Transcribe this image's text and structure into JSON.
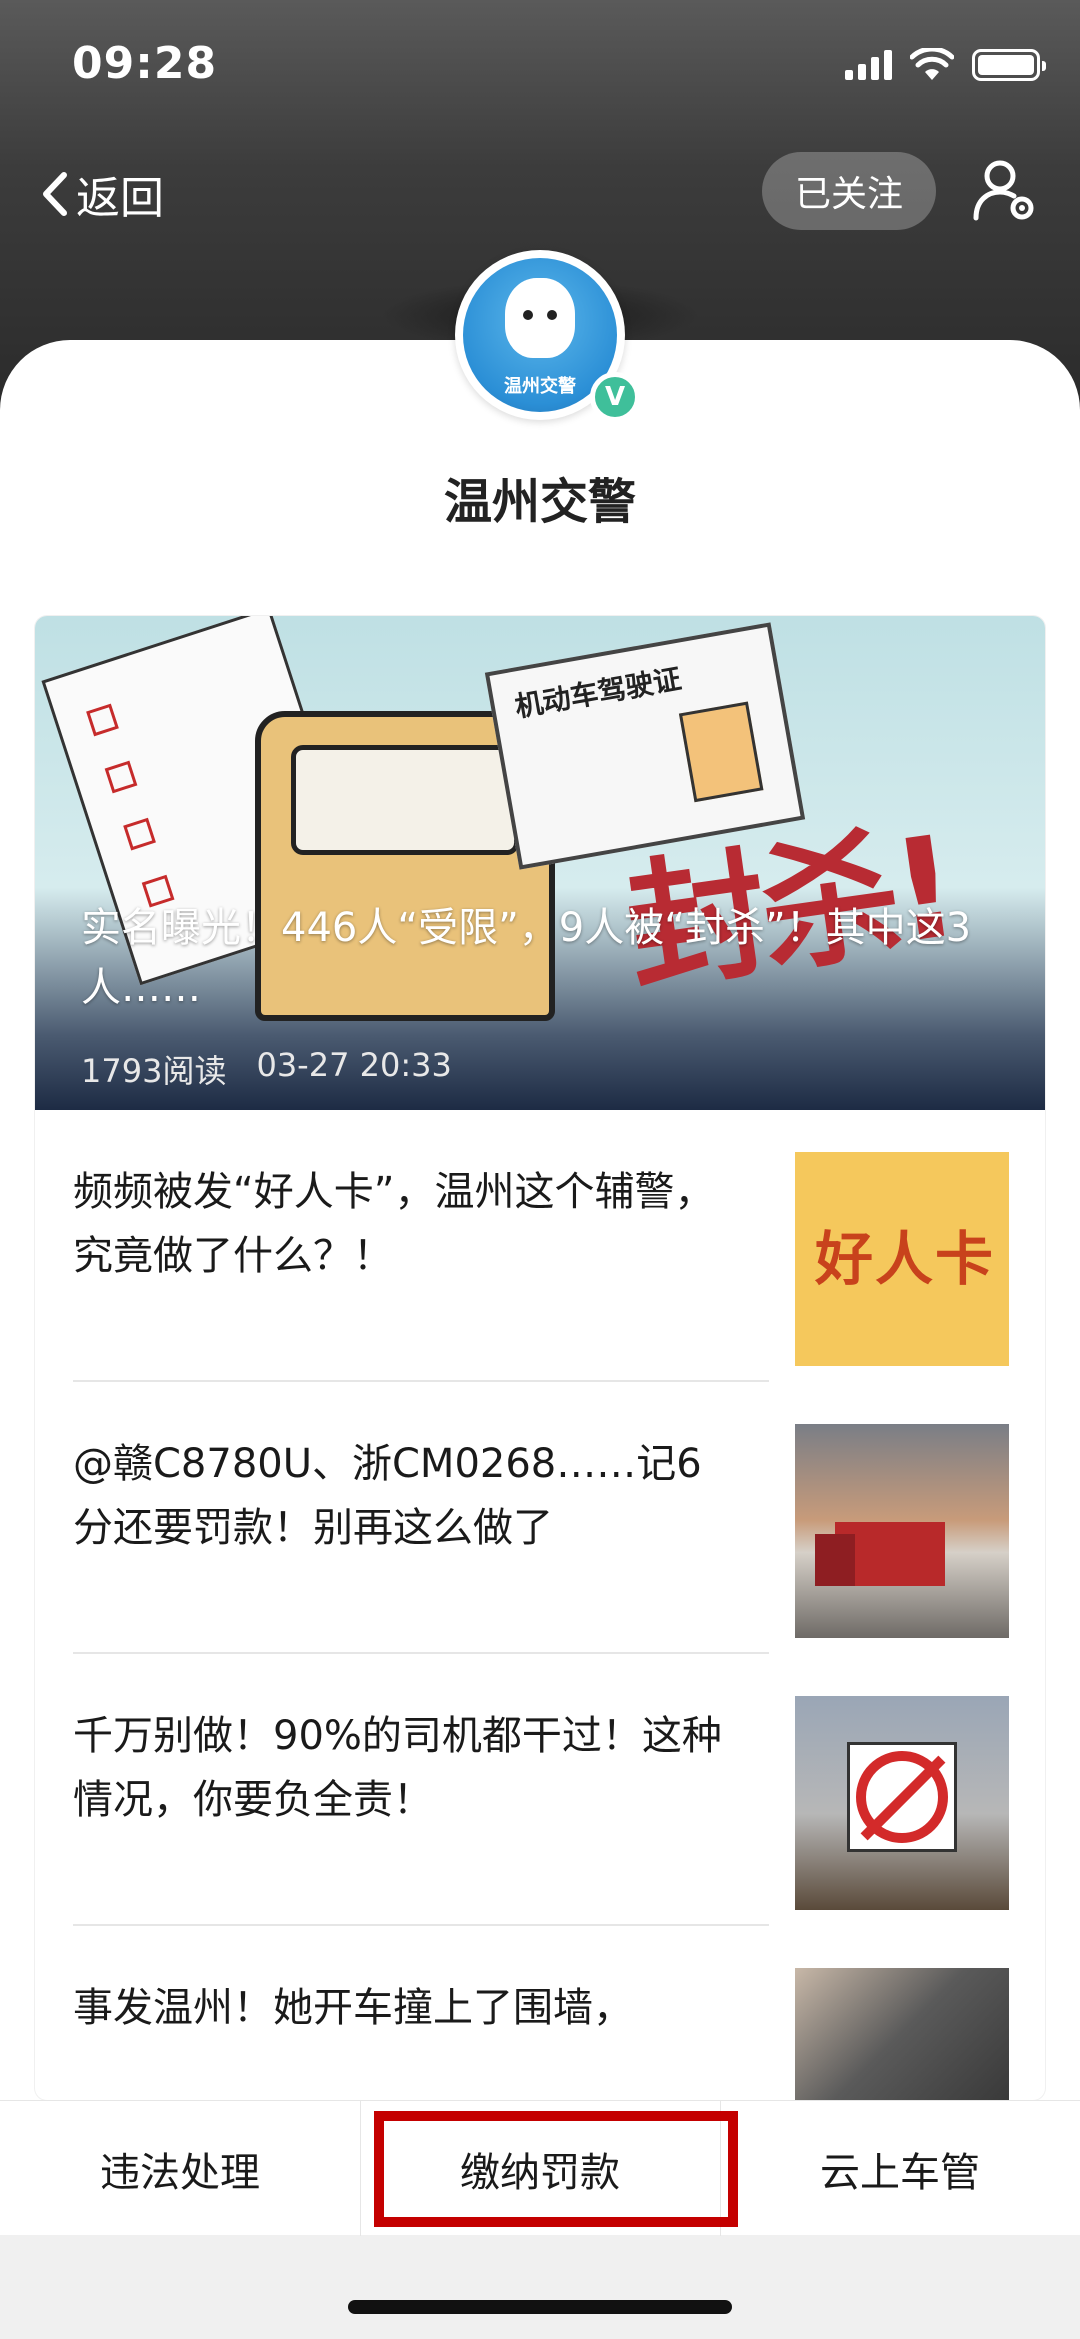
{
  "status_bar": {
    "time": "09:28",
    "signal_icon": "signal-icon",
    "wifi_icon": "wifi-icon",
    "battery_icon": "battery-icon"
  },
  "nav": {
    "back_label": "返回",
    "follow_label": "已关注",
    "settings_icon": "user-settings-icon"
  },
  "account": {
    "name": "温州交警",
    "avatar_text": "温州交警",
    "verified_badge": "V"
  },
  "hero": {
    "title": "实名曝光！446人“受限”，9人被“封杀”！其中这3人……",
    "reads": "1793阅读",
    "date": "03-27 20:33",
    "license_title": "机动车驾驶证",
    "stamp_text": "封杀!"
  },
  "articles": [
    {
      "title": "频频被发“好人卡”，温州这个辅警，究竟做了什么？！",
      "thumb_text": "好人卡"
    },
    {
      "title": "@赣C8780U、浙CM0268……记6分还要罚款！别再这么做了"
    },
    {
      "title": "千万别做！90%的司机都干过！这种情况，你要负全责！"
    },
    {
      "title": "事发温州！她开车撞上了围墙，"
    }
  ],
  "tabbar": {
    "items": [
      "违法处理",
      "缴纳罚款",
      "云上车管"
    ]
  },
  "colors": {
    "highlight": "#c40000",
    "verified": "#3fbf9a"
  }
}
